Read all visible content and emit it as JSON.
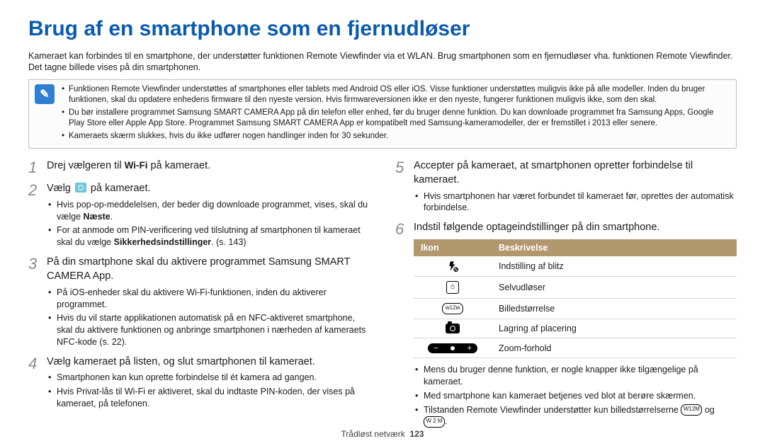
{
  "title": "Brug af en smartphone som en fjernudløser",
  "intro": "Kameraet kan forbindes til en smartphone, der understøtter funktionen Remote Viewfinder via et WLAN. Brug smartphonen som en fjernudløser vha. funktionen Remote Viewfinder. Det tagne billede vises på din smartphonen.",
  "note_icon": "✎",
  "notes": [
    "Funktionen Remote Viewfinder understøttes af smartphones eller tablets med Android OS eller iOS. Visse funktioner understøttes muligvis ikke på alle modeller. Inden du bruger funktionen, skal du opdatere enhedens firmware til den nyeste version. Hvis firmwareversionen ikke er den nyeste, fungerer funktionen muligvis ikke, som den skal.",
    "Du bør installere programmet Samsung SMART CAMERA App på din telefon eller enhed, før du bruger denne funktion. Du kan downloade programmet fra Samsung Apps, Google Play Store eller Apple App Store. Programmet Samsung SMART CAMERA App er kompatibelt med Samsung-kameramodeller, der er fremstillet i 2013 eller senere.",
    "Kameraets skærm slukkes, hvis du ikke udfører nogen handlinger inden for 30 sekunder."
  ],
  "left": {
    "steps": [
      {
        "num": "1",
        "text_before": "Drej vælgeren til ",
        "wifi": "Wi-Fi",
        "text_after": " på kameraet."
      },
      {
        "num": "2",
        "text_before": "Vælg ",
        "text_after": " på kameraet.",
        "subs": [
          {
            "plain": "Hvis pop-op-meddelelsen, der beder dig downloade programmet, vises, skal du vælge ",
            "bold": "Næste",
            "tail": "."
          },
          {
            "plain": "For at anmode om PIN-verificering ved tilslutning af smartphonen til kameraet skal du vælge ",
            "bold": "Sikkerhedsindstillinger",
            "tail": ". (s. 143)"
          }
        ]
      },
      {
        "num": "3",
        "text": "På din smartphone skal du aktivere programmet Samsung SMART CAMERA App.",
        "subs": [
          {
            "plain": "På iOS-enheder skal du aktivere Wi-Fi-funktionen, inden du aktiverer programmet."
          },
          {
            "plain": "Hvis du vil starte applikationen automatisk på en NFC-aktiveret smartphone, skal du aktivere funktionen og anbringe smartphonen i nærheden af kameraets NFC-kode (s. 22)."
          }
        ]
      },
      {
        "num": "4",
        "text": "Vælg kameraet på listen, og slut smartphonen til kameraet.",
        "subs": [
          {
            "plain": "Smartphonen kan kun oprette forbindelse til ét kamera ad gangen."
          },
          {
            "plain": "Hvis Privat-lås til Wi-Fi er aktiveret, skal du indtaste PIN-koden, der vises på kameraet, på telefonen."
          }
        ]
      }
    ]
  },
  "right": {
    "steps": [
      {
        "num": "5",
        "text": "Accepter på kameraet, at smartphonen opretter forbindelse til kameraet.",
        "subs": [
          {
            "plain": "Hvis smartphonen har været forbundet til kameraet før, oprettes der automatisk forbindelse."
          }
        ]
      },
      {
        "num": "6",
        "text": "Indstil følgende optageindstillinger på din smartphone."
      }
    ],
    "table": {
      "headers": {
        "icon": "Ikon",
        "desc": "Beskrivelse"
      },
      "rows": [
        {
          "desc": "Indstilling af blitz"
        },
        {
          "desc": "Selvudløser"
        },
        {
          "desc": "Billedstørrelse"
        },
        {
          "desc": "Lagring af placering"
        },
        {
          "desc": "Zoom-forhold"
        }
      ]
    },
    "post_subs": [
      {
        "plain": "Mens du bruger denne funktion, er nogle knapper ikke tilgængelige på kameraet."
      },
      {
        "plain": "Med smartphone kan kameraet betjenes ved blot at berøre skærmen."
      },
      {
        "plain_before": "Tilstanden Remote Viewfinder understøtter kun billedstørrelserne ",
        "size1": "W12M",
        "mid": " og ",
        "size2": "W 2 M",
        "tail": "."
      }
    ]
  },
  "footer": {
    "section": "Trådløst netværk",
    "page": "123"
  }
}
